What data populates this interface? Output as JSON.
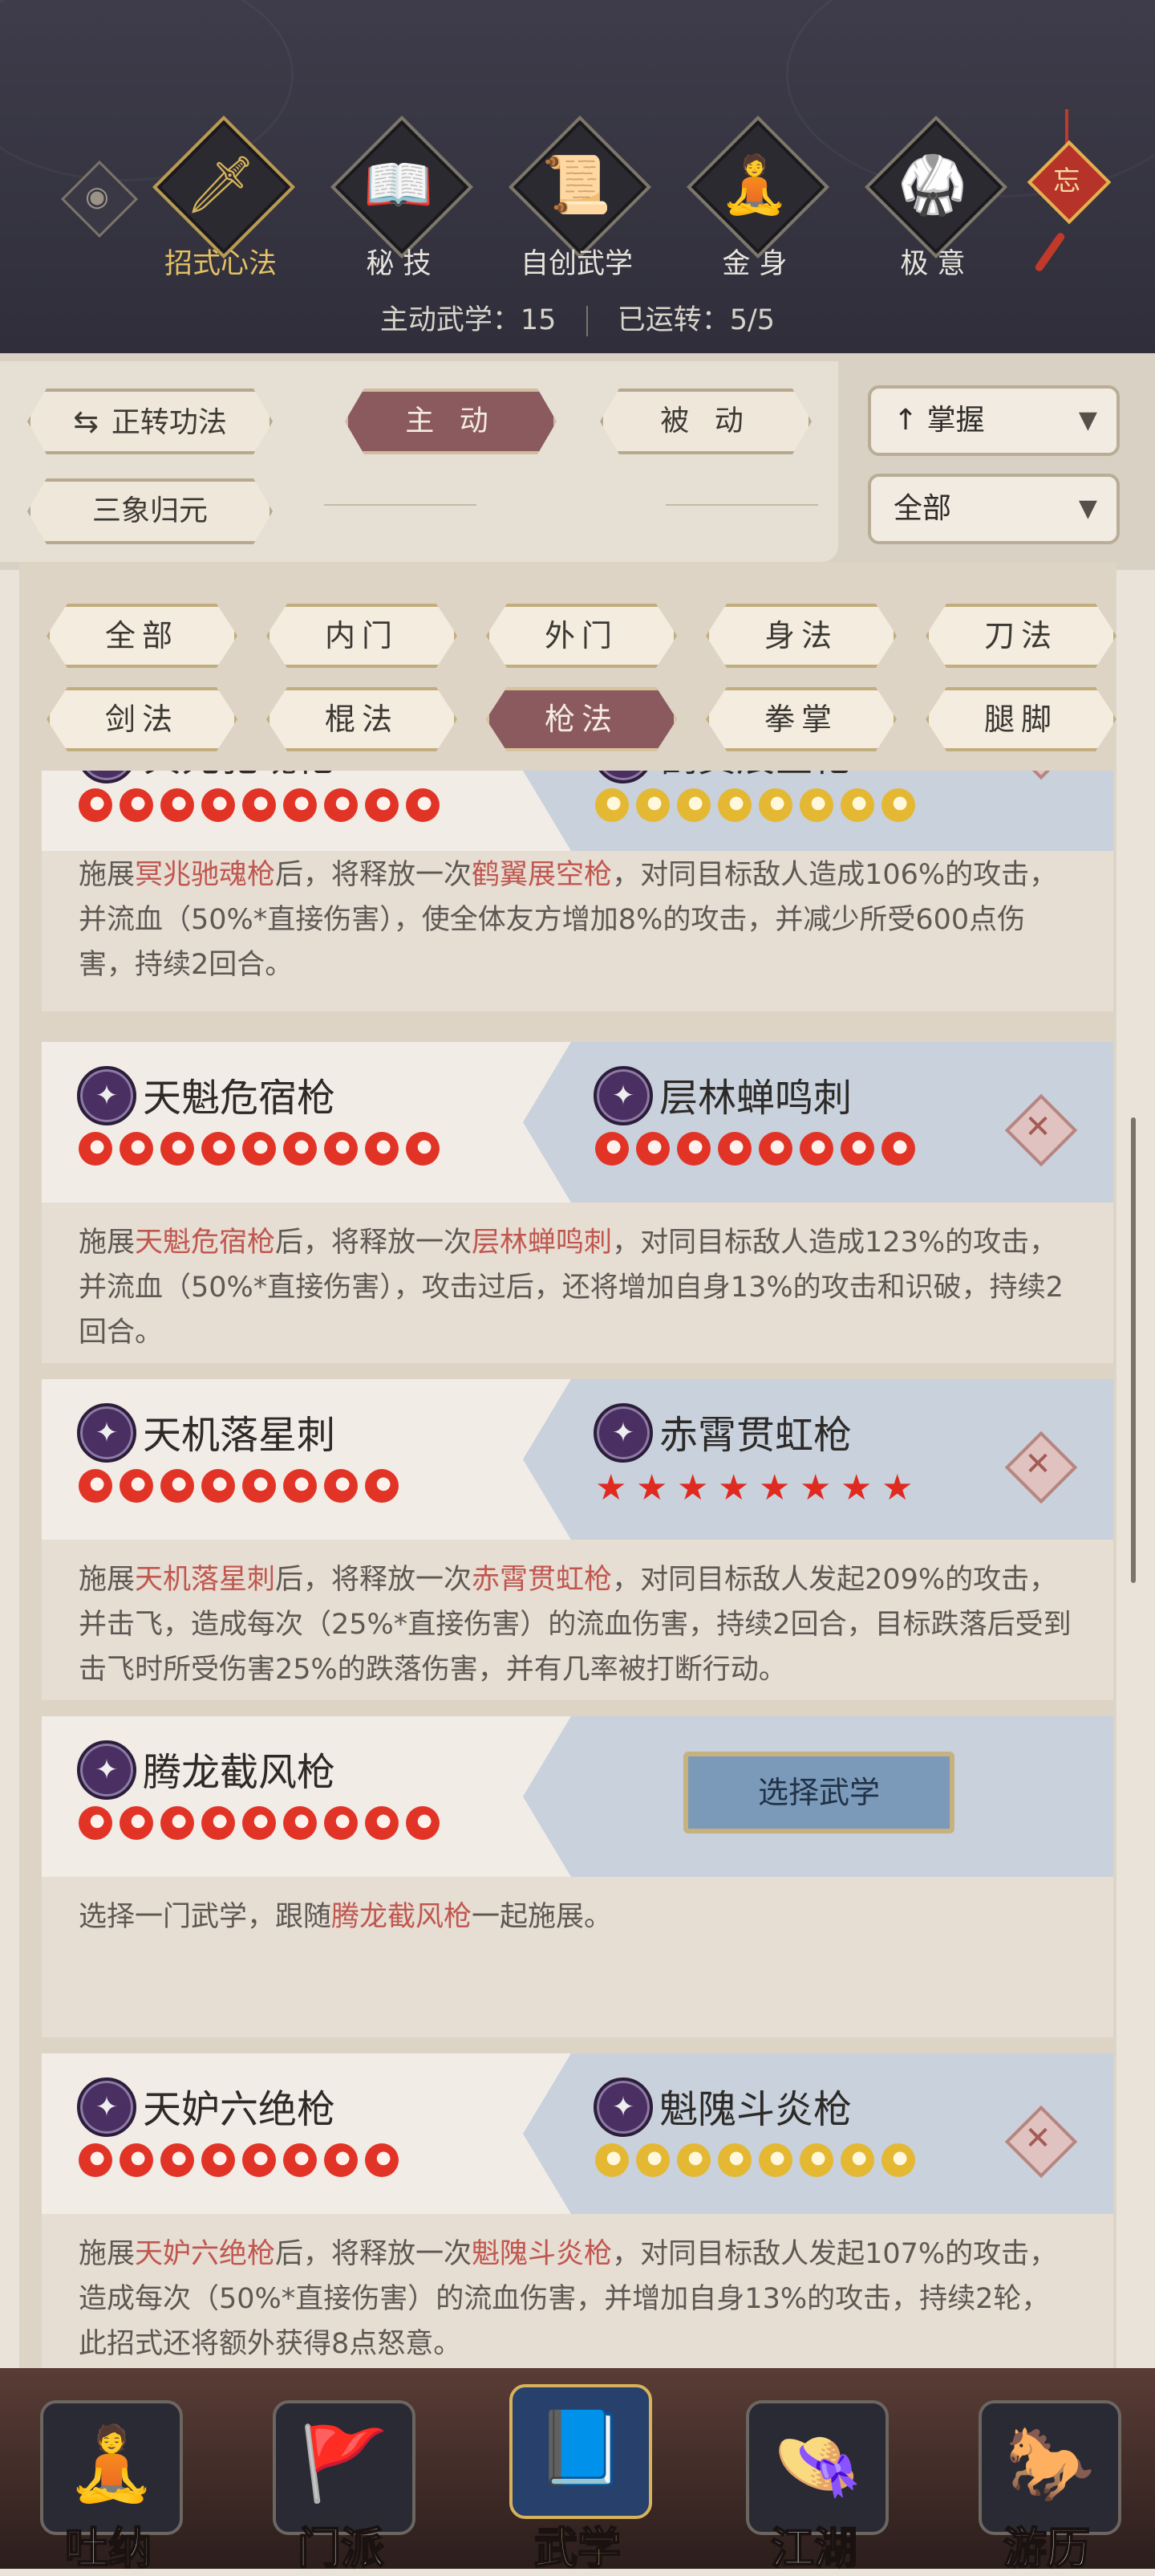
{
  "header": {
    "tabs": [
      {
        "label": "招式心法",
        "icon": "sword-icon",
        "glyph": "🗡",
        "active": true
      },
      {
        "label": "秘 技",
        "icon": "book-icon",
        "glyph": "📖",
        "active": false
      },
      {
        "label": "自创武学",
        "icon": "scroll-icon",
        "glyph": "📜",
        "active": false
      },
      {
        "label": "金 身",
        "icon": "meditation-icon",
        "glyph": "🧘",
        "active": false
      },
      {
        "label": "极 意",
        "icon": "martial-stance-icon",
        "glyph": "🥋",
        "active": false
      }
    ],
    "eye_glyph": "◉",
    "charm_glyph": "忘",
    "stats": {
      "active_label": "主动武学：15",
      "running_label": "已运转：5/5"
    }
  },
  "filters": {
    "forward_button": "正转功法",
    "forward_icon": "⇆",
    "active_tab": "主 动",
    "passive_tab": "被 动",
    "sanxiang_button": "三象归元",
    "sort_dropdown": "掌握",
    "sort_icon": "↑",
    "scope_dropdown": "全部",
    "caret": "▼"
  },
  "categories": [
    {
      "label": "全部",
      "active": false
    },
    {
      "label": "内门",
      "active": false
    },
    {
      "label": "外门",
      "active": false
    },
    {
      "label": "身法",
      "active": false
    },
    {
      "label": "刀法",
      "active": false
    },
    {
      "label": "剑法",
      "active": false
    },
    {
      "label": "棍法",
      "active": false
    },
    {
      "label": "枪法",
      "active": true
    },
    {
      "label": "拳掌",
      "active": false
    },
    {
      "label": "腿脚",
      "active": false
    }
  ],
  "combos": [
    {
      "left_name": "冥兆驰魂枪",
      "right_name": "鹤翼展空枪",
      "left_rank": {
        "count": 9,
        "kind": "red"
      },
      "right_rank": {
        "count": 8,
        "kind": "gold"
      },
      "desc_parts": [
        "施展",
        "冥兆驰魂枪",
        "后，将释放一次",
        "鹤翼展空枪",
        "，对同目标敌人造成106%的攻击，并流血（50%*直接伤害），使全体友方增加8%的攻击，并减少所受600点伤害，持续2回合。"
      ]
    },
    {
      "left_name": "天魁危宿枪",
      "right_name": "层林蝉鸣刺",
      "left_rank": {
        "count": 9,
        "kind": "red"
      },
      "right_rank": {
        "count": 8,
        "kind": "red"
      },
      "desc_parts": [
        "施展",
        "天魁危宿枪",
        "后，将释放一次",
        "层林蝉鸣刺",
        "，对同目标敌人造成123%的攻击，并流血（50%*直接伤害），攻击过后，还将增加自身13%的攻击和识破，持续2回合。"
      ]
    },
    {
      "left_name": "天机落星刺",
      "right_name": "赤霄贯虹枪",
      "left_rank": {
        "count": 8,
        "kind": "red"
      },
      "right_rank": {
        "count": 8,
        "kind": "star"
      },
      "desc_parts": [
        "施展",
        "天机落星刺",
        "后，将释放一次",
        "赤霄贯虹枪",
        "，对同目标敌人发起209%的攻击，并击飞，造成每次（25%*直接伤害）的流血伤害，持续2回合，目标跌落后受到击飞时所受伤害25%的跌落伤害，并有几率被打断行动。"
      ]
    },
    {
      "left_name": "腾龙截风枪",
      "select_label": "选择武学",
      "left_rank": {
        "count": 9,
        "kind": "red"
      },
      "desc_parts": [
        "选择一门武学，跟随",
        "腾龙截风枪",
        "一起施展。"
      ]
    },
    {
      "left_name": "天妒六绝枪",
      "right_name": "魁隗斗炎枪",
      "left_rank": {
        "count": 8,
        "kind": "red"
      },
      "right_rank": {
        "count": 8,
        "kind": "gold"
      },
      "desc_parts": [
        "施展",
        "天妒六绝枪",
        "后，将释放一次",
        "魁隗斗炎枪",
        "，对同目标敌人发起107%的攻击，造成每次（50%*直接伤害）的流血伤害，并增加自身13%的攻击，持续2轮，此招式还将额外获得8点怒意。"
      ]
    }
  ],
  "remove_glyph": "✕",
  "spear_glyph": "✦",
  "star_glyph": "★",
  "bottom_nav": [
    {
      "label": "吐纳",
      "icon": "monk-icon",
      "glyph": "🧘",
      "active": false
    },
    {
      "label": "门派",
      "icon": "flags-icon",
      "glyph": "🚩",
      "active": false
    },
    {
      "label": "武学",
      "icon": "manual-book-icon",
      "glyph": "📘",
      "active": true
    },
    {
      "label": "江湖",
      "icon": "straw-hat-icon",
      "glyph": "👒",
      "active": false
    },
    {
      "label": "游历",
      "icon": "horse-icon",
      "glyph": "🐎",
      "active": false
    }
  ]
}
